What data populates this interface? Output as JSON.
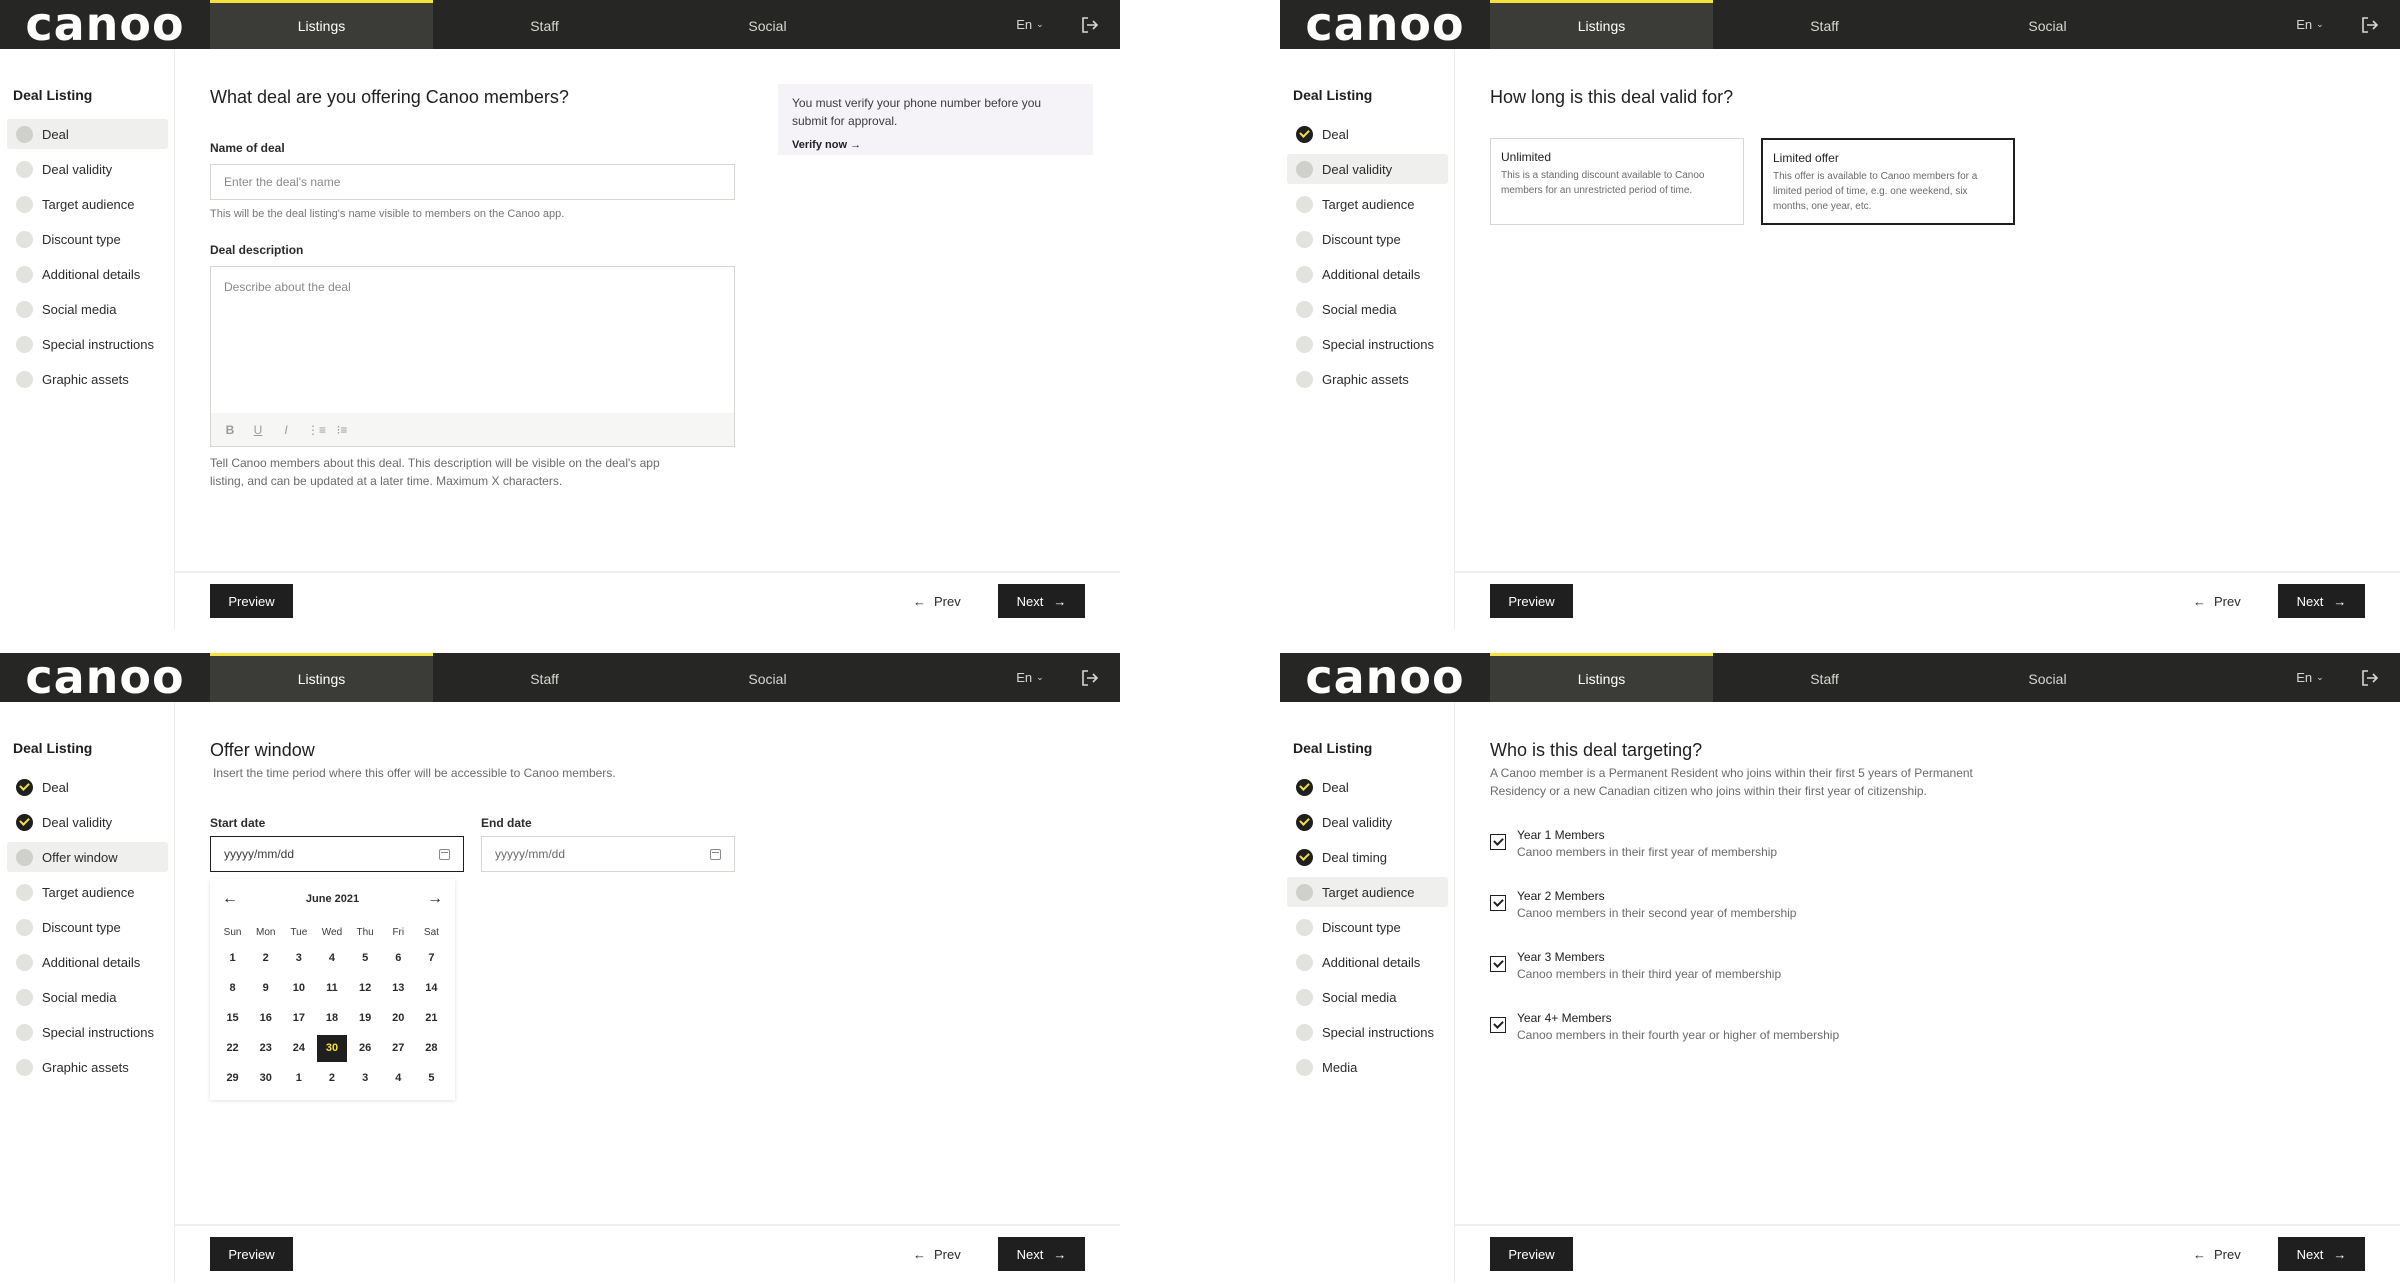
{
  "brand": "canoo",
  "nav": {
    "tabs": [
      "Listings",
      "Staff",
      "Social"
    ],
    "lang": "En"
  },
  "sidebar_title": "Deal Listing",
  "footer": {
    "preview": "Preview",
    "prev": "Prev",
    "next": "Next"
  },
  "colors": {
    "dark": "#262624",
    "accent": "#f4e33a",
    "notice_bg": "#f6f3f8"
  },
  "panel1": {
    "steps": [
      "Deal",
      "Deal validity",
      "Target audience",
      "Discount type",
      "Additional details",
      "Social media",
      "Special instructions",
      "Graphic assets"
    ],
    "heading": "What deal are you offering Canoo members?",
    "name_label": "Name of deal",
    "name_placeholder": "Enter the deal's name",
    "name_helper": "This will be the deal listing's name visible to members on the Canoo app.",
    "desc_label": "Deal description",
    "desc_placeholder": "Describe about the deal",
    "toolbar": [
      "B",
      "U",
      "I",
      "ordered-list-icon",
      "bullet-list-icon"
    ],
    "desc_helper_1": " Tell Canoo members about this deal. This description will be visible on the deal's app",
    "desc_helper_2": "listing, and can be updated at a later time. Maximum X characters.",
    "notice_1": "You must verify your phone number before you",
    "notice_2": "submit for approval.",
    "verify": "Verify now"
  },
  "panel2": {
    "steps": [
      "Deal",
      "Deal validity",
      "Target audience",
      "Discount type",
      "Additional details",
      "Social media",
      "Special instructions",
      "Graphic assets"
    ],
    "heading": "How long is this deal valid for?",
    "cards": [
      {
        "title": "Unlimited",
        "desc": "This is a standing discount available to Canoo members for an unrestricted period of time."
      },
      {
        "title": "Limited offer",
        "desc": "This offer is available to Canoo members for a limited period of time, e.g. one weekend, six months, one year, etc."
      }
    ]
  },
  "panel3": {
    "steps": [
      "Deal",
      "Deal validity",
      "Offer window",
      "Target audience",
      "Discount type",
      "Additional details",
      "Social media",
      "Special instructions",
      "Graphic assets"
    ],
    "heading": "Offer window",
    "subtext": "Insert the time period where this offer will be accessible to Canoo members.",
    "start_label": "Start date",
    "end_label": "End date",
    "date_placeholder": "yyyyy/mm/dd",
    "calendar": {
      "month": "June 2021",
      "dows": [
        "Sun",
        "Mon",
        "Tue",
        "Wed",
        "Thu",
        "Fri",
        "Sat"
      ],
      "days": [
        "1",
        "2",
        "3",
        "4",
        "5",
        "6",
        "7",
        "8",
        "9",
        "10",
        "11",
        "12",
        "13",
        "14",
        "15",
        "16",
        "17",
        "18",
        "19",
        "20",
        "21",
        "22",
        "23",
        "24",
        "30",
        "26",
        "27",
        "28",
        "29",
        "30",
        "1",
        "2",
        "3",
        "4",
        "5"
      ],
      "selected_index": 24
    }
  },
  "panel4": {
    "steps": [
      "Deal",
      "Deal validity",
      "Deal timing",
      "Target audience",
      "Discount type",
      "Additional details",
      "Social media",
      "Special instructions",
      "Media"
    ],
    "heading": "Who is this deal targeting?",
    "subtext_1": "A Canoo member is a Permanent Resident who joins within their first 5 years of Permanent",
    "subtext_2": "Residency or a new Canadian citizen who joins within their first year of citizenship.",
    "members": [
      {
        "title": "Year 1 Members",
        "desc": "Canoo members in their first year of membership"
      },
      {
        "title": "Year 2 Members",
        "desc": "Canoo members in their second year of membership"
      },
      {
        "title": "Year 3 Members",
        "desc": "Canoo members in their third year of membership"
      },
      {
        "title": "Year 4+ Members",
        "desc": "Canoo members in their fourth year or higher of membership"
      }
    ]
  }
}
